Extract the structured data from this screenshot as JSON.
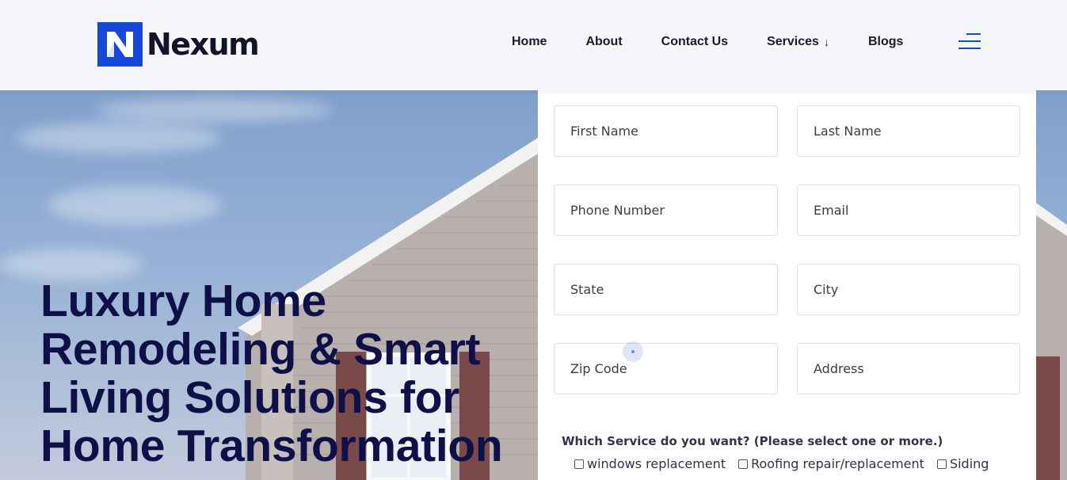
{
  "brand": {
    "name": "Nexum",
    "accent": "#1747d6",
    "text_color": "#13132a"
  },
  "nav": {
    "items": [
      {
        "label": "Home"
      },
      {
        "label": "About"
      },
      {
        "label": "Contact Us"
      },
      {
        "label": "Services"
      },
      {
        "label": "Blogs"
      }
    ],
    "services_icon": "arrow-down-icon",
    "menu_icon": "hamburger-menu-icon"
  },
  "hero": {
    "title_lines": [
      "Luxury Home",
      "Remodeling & Smart",
      "Living Solutions for",
      "Home Transformation"
    ],
    "title_color": "#0f1048"
  },
  "form": {
    "fields": {
      "first_name": "First Name",
      "last_name": "Last Name",
      "phone": "Phone Number",
      "email": "Email",
      "state": "State",
      "city": "City",
      "zip": "Zip Code",
      "address": "Address"
    },
    "service_question": "Which Service do you want? (Please select one or more.)",
    "services": [
      {
        "label": "windows replacement",
        "checked": false
      },
      {
        "label": "Roofing repair/replacement",
        "checked": false
      },
      {
        "label": "Siding",
        "checked": false
      }
    ]
  }
}
